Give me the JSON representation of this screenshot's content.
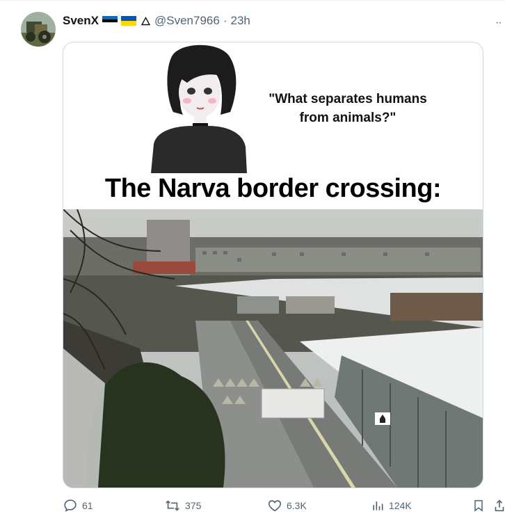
{
  "tweet": {
    "author_name": "SvenX",
    "handle": "@Sven7966",
    "separator": "·",
    "time": "23h",
    "more_label": "··",
    "flags": [
      "estonia-flag",
      "ukraine-flag"
    ],
    "media": {
      "quote_line1": "\"What separates humans",
      "quote_line2": "from animals?\"",
      "caption": "The Narva border crossing:"
    },
    "actions": {
      "replies": "61",
      "reposts": "375",
      "likes": "6.3K",
      "views": "124K"
    },
    "icons": [
      "reply-icon",
      "repost-icon",
      "like-icon",
      "views-icon",
      "bookmark-icon",
      "share-icon"
    ],
    "colors": {
      "text": "#0f1419",
      "muted": "#536471",
      "border": "#cfd9de"
    }
  }
}
